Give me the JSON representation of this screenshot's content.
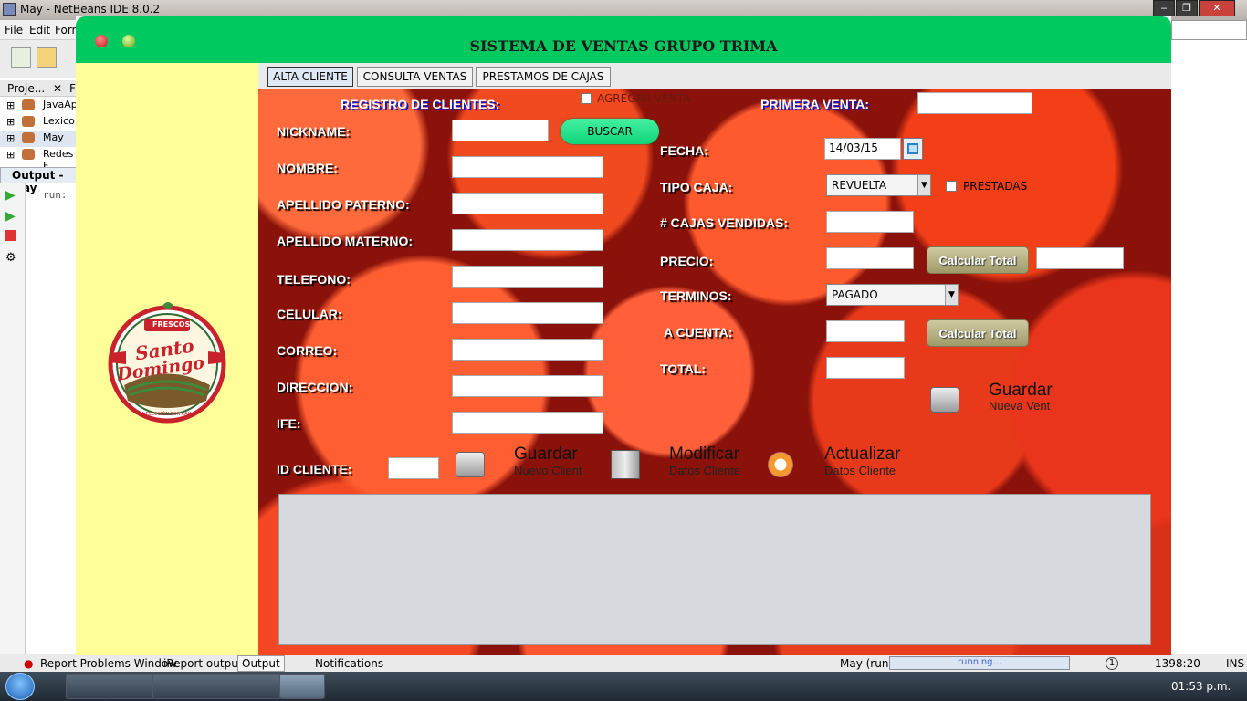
{
  "netbeans": {
    "window_title": "May - NetBeans IDE 8.0.2",
    "menu": [
      "File",
      "Edit",
      "Form"
    ],
    "projects_tab": "Proje...",
    "files_tab": "F",
    "projects": [
      "JavaAp",
      "Lexico",
      "May",
      "Redes F"
    ],
    "output_tab": "Output - May",
    "output_text": "run:",
    "status": {
      "report_problems": "Report Problems Window",
      "ireport": "iReport output",
      "output": "Output",
      "notifications": "Notifications",
      "run_label": "May (run)",
      "progress_text": "running...",
      "badge": "1",
      "position": "1398:20",
      "mode": "INS"
    }
  },
  "taskbar": {
    "clock": "01:53 p.m."
  },
  "app": {
    "title": "SISTEMA DE VENTAS GRUPO TRIMA",
    "tabs": [
      {
        "label": "ALTA CLIENTE",
        "selected": true
      },
      {
        "label": "CONSULTA VENTAS",
        "selected": false
      },
      {
        "label": "PRESTAMOS DE CAJAS",
        "selected": false
      }
    ],
    "logo": {
      "top": "FRESCOS",
      "line1": "Santo",
      "line2": "Domingo",
      "tagline": "LA ELECCIÓN POR CAJAS"
    },
    "clientes": {
      "heading": "REGISTRO DE CLIENTES:",
      "agregar_venta": "AGREGAR VENTA",
      "buscar": "BUSCAR",
      "fields": {
        "nickname": "NICKNAME:",
        "nombre": "NOMBRE:",
        "apellido_paterno": "APELLIDO PATERNO:",
        "apellido_materno": "APELLIDO MATERNO:",
        "telefono": "TELEFONO:",
        "celular": "CELULAR:",
        "correo": "CORREO:",
        "direccion": "DIRECCION:",
        "ife": "IFE:",
        "id_cliente": "ID CLIENTE:"
      },
      "actions": {
        "guardar": "Guardar",
        "guardar_sub": "Nuevo Client",
        "modificar": "Modificar",
        "modificar_sub": "Datos Cliente",
        "actualizar": "Actualizar",
        "actualizar_sub": "Datos Cliente"
      }
    },
    "venta": {
      "primera_venta": "PRIMERA VENTA:",
      "fecha_label": "FECHA:",
      "fecha_value": "14/03/15",
      "tipo_caja_label": "TIPO CAJA:",
      "tipo_caja_value": "REVUELTA",
      "prestadas": "PRESTADAS",
      "cajas_vendidas": "# CAJAS VENDIDAS:",
      "precio": "PRECIO:",
      "calcular_total": "Calcular Total",
      "terminos_label": "TERMINOS:",
      "terminos_value": "PAGADO",
      "a_cuenta": "A CUENTA:",
      "total": "TOTAL:",
      "guardar": "Guardar",
      "guardar_sub": "Nueva Vent"
    }
  }
}
